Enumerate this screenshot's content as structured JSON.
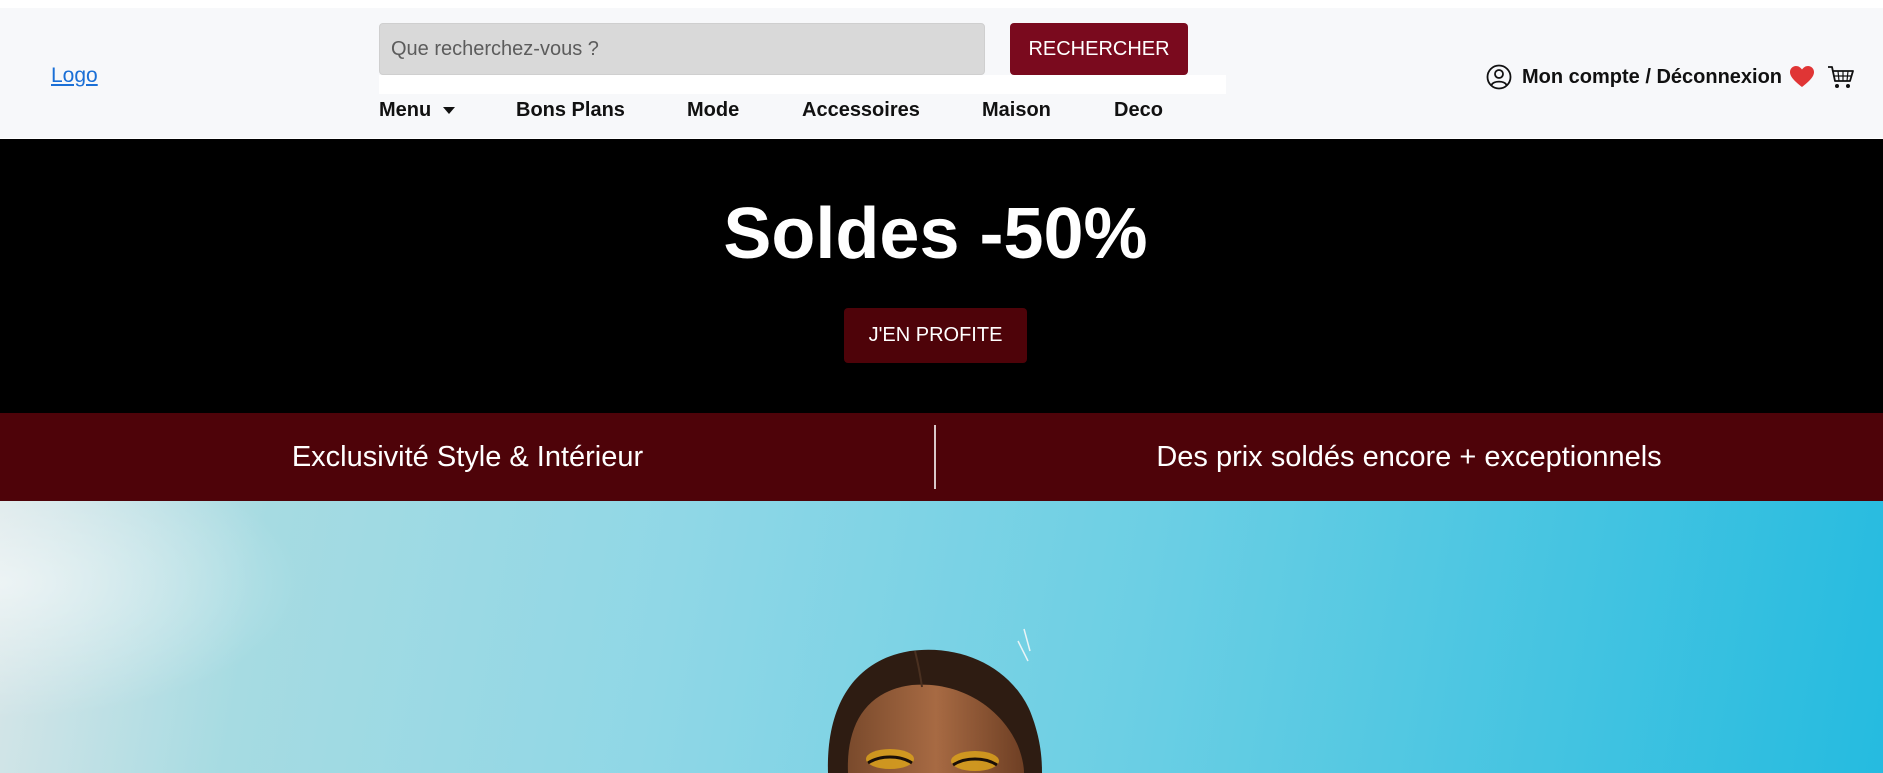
{
  "header": {
    "logo_text": "Logo",
    "search": {
      "placeholder": "Que recherchez-vous ?",
      "button_label": "RECHERCHER"
    },
    "nav": {
      "items": [
        "Menu",
        "Bons Plans",
        "Mode",
        "Accessoires",
        "Maison",
        "Deco"
      ]
    },
    "account_label": "Mon compte / Déconnexion",
    "icons": [
      "user-icon",
      "heart-icon",
      "cart-icon",
      "chevron-down-icon"
    ]
  },
  "hero": {
    "title": "Soldes -50%",
    "cta_label": "J'EN PROFITE"
  },
  "band": {
    "left_text": "Exclusivité Style & Intérieur",
    "right_text": "Des prix soldés encore + exceptionnels"
  },
  "colors": {
    "brand": "#7a0a1e",
    "band": "#4e0309",
    "hero_bg": "#000000",
    "header_bg": "#f7f8fa",
    "heart": "#e03535",
    "link": "#1a6fd6"
  }
}
